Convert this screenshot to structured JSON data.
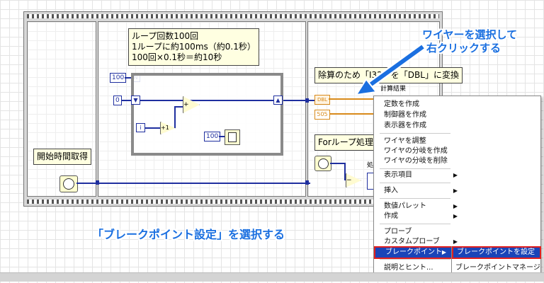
{
  "notes": {
    "loop_note_line1": "ループ回数100回",
    "loop_note_line2": "1ループに約100ms（約0.1秒）",
    "loop_note_line3": "100回×0.1秒＝約10秒",
    "start_time_note": "開始時間取得",
    "divide_note": "除算のため「I32」を「DBL」に変換",
    "for_loop_note": "Forループ処理完"
  },
  "diagram": {
    "const_100_top": "100",
    "n_terminal": "N",
    "const_0": "0",
    "i_terminal": "i",
    "plus1_label": "+1",
    "add_label": "+",
    "wait_const": "100",
    "dbl_label": "DBL",
    "const_505": "505",
    "calc_result_label": "計算結果",
    "minus_label": "−",
    "partial_label": "処"
  },
  "annotations": {
    "select_wire_line1": "ワイヤーを選択して",
    "select_wire_line2": "右クリックする",
    "select_breakpoint": "「ブレークポイント設定」を選択する",
    "accent_color": "#1a6fe0"
  },
  "context_menu": {
    "items": [
      {
        "label": "定数を作成"
      },
      {
        "label": "制御器を作成"
      },
      {
        "label": "表示器を作成"
      },
      {
        "label": "ワイヤを調整"
      },
      {
        "label": "ワイヤの分岐を作成"
      },
      {
        "label": "ワイヤの分岐を削除"
      },
      {
        "label": "表示項目"
      },
      {
        "label": "挿入"
      },
      {
        "label": "数値パレット"
      },
      {
        "label": "作成"
      },
      {
        "label": "プローブ"
      },
      {
        "label": "カスタムプローブ"
      },
      {
        "label": "ブレークポイント"
      },
      {
        "label": "説明とヒント..."
      }
    ],
    "submenu": [
      {
        "label": "ブレークポイントを設定"
      },
      {
        "label": "ブレークポイントマネージャ"
      }
    ],
    "highlight_color": "#1a44b8"
  }
}
